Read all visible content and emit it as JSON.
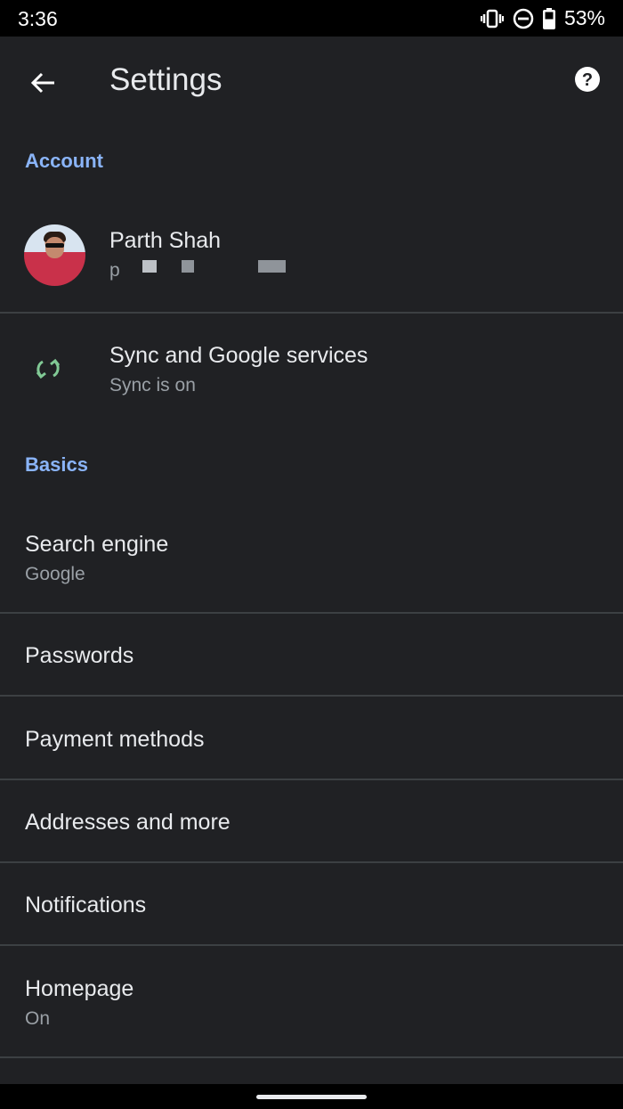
{
  "status_bar": {
    "time": "3:36",
    "battery": "53%",
    "icons": [
      "vibrate-icon",
      "do-not-disturb-icon",
      "battery-icon"
    ]
  },
  "app_bar": {
    "title": "Settings",
    "back_icon": "arrow-back-icon",
    "help_icon": "help-icon"
  },
  "sections": {
    "account": {
      "header": "Account"
    },
    "basics": {
      "header": "Basics"
    }
  },
  "account": {
    "name": "Parth Shah",
    "email_prefix": "p"
  },
  "sync": {
    "title": "Sync and Google services",
    "subtitle": "Sync is on",
    "icon": "sync-icon"
  },
  "basics_items": [
    {
      "title": "Search engine",
      "subtitle": "Google"
    },
    {
      "title": "Passwords"
    },
    {
      "title": "Payment methods"
    },
    {
      "title": "Addresses and more"
    },
    {
      "title": "Notifications"
    },
    {
      "title": "Homepage",
      "subtitle": "On"
    }
  ],
  "colors": {
    "background": "#202124",
    "accent": "#8ab4f8",
    "sync_green": "#81c995",
    "divider": "#3c4043"
  }
}
